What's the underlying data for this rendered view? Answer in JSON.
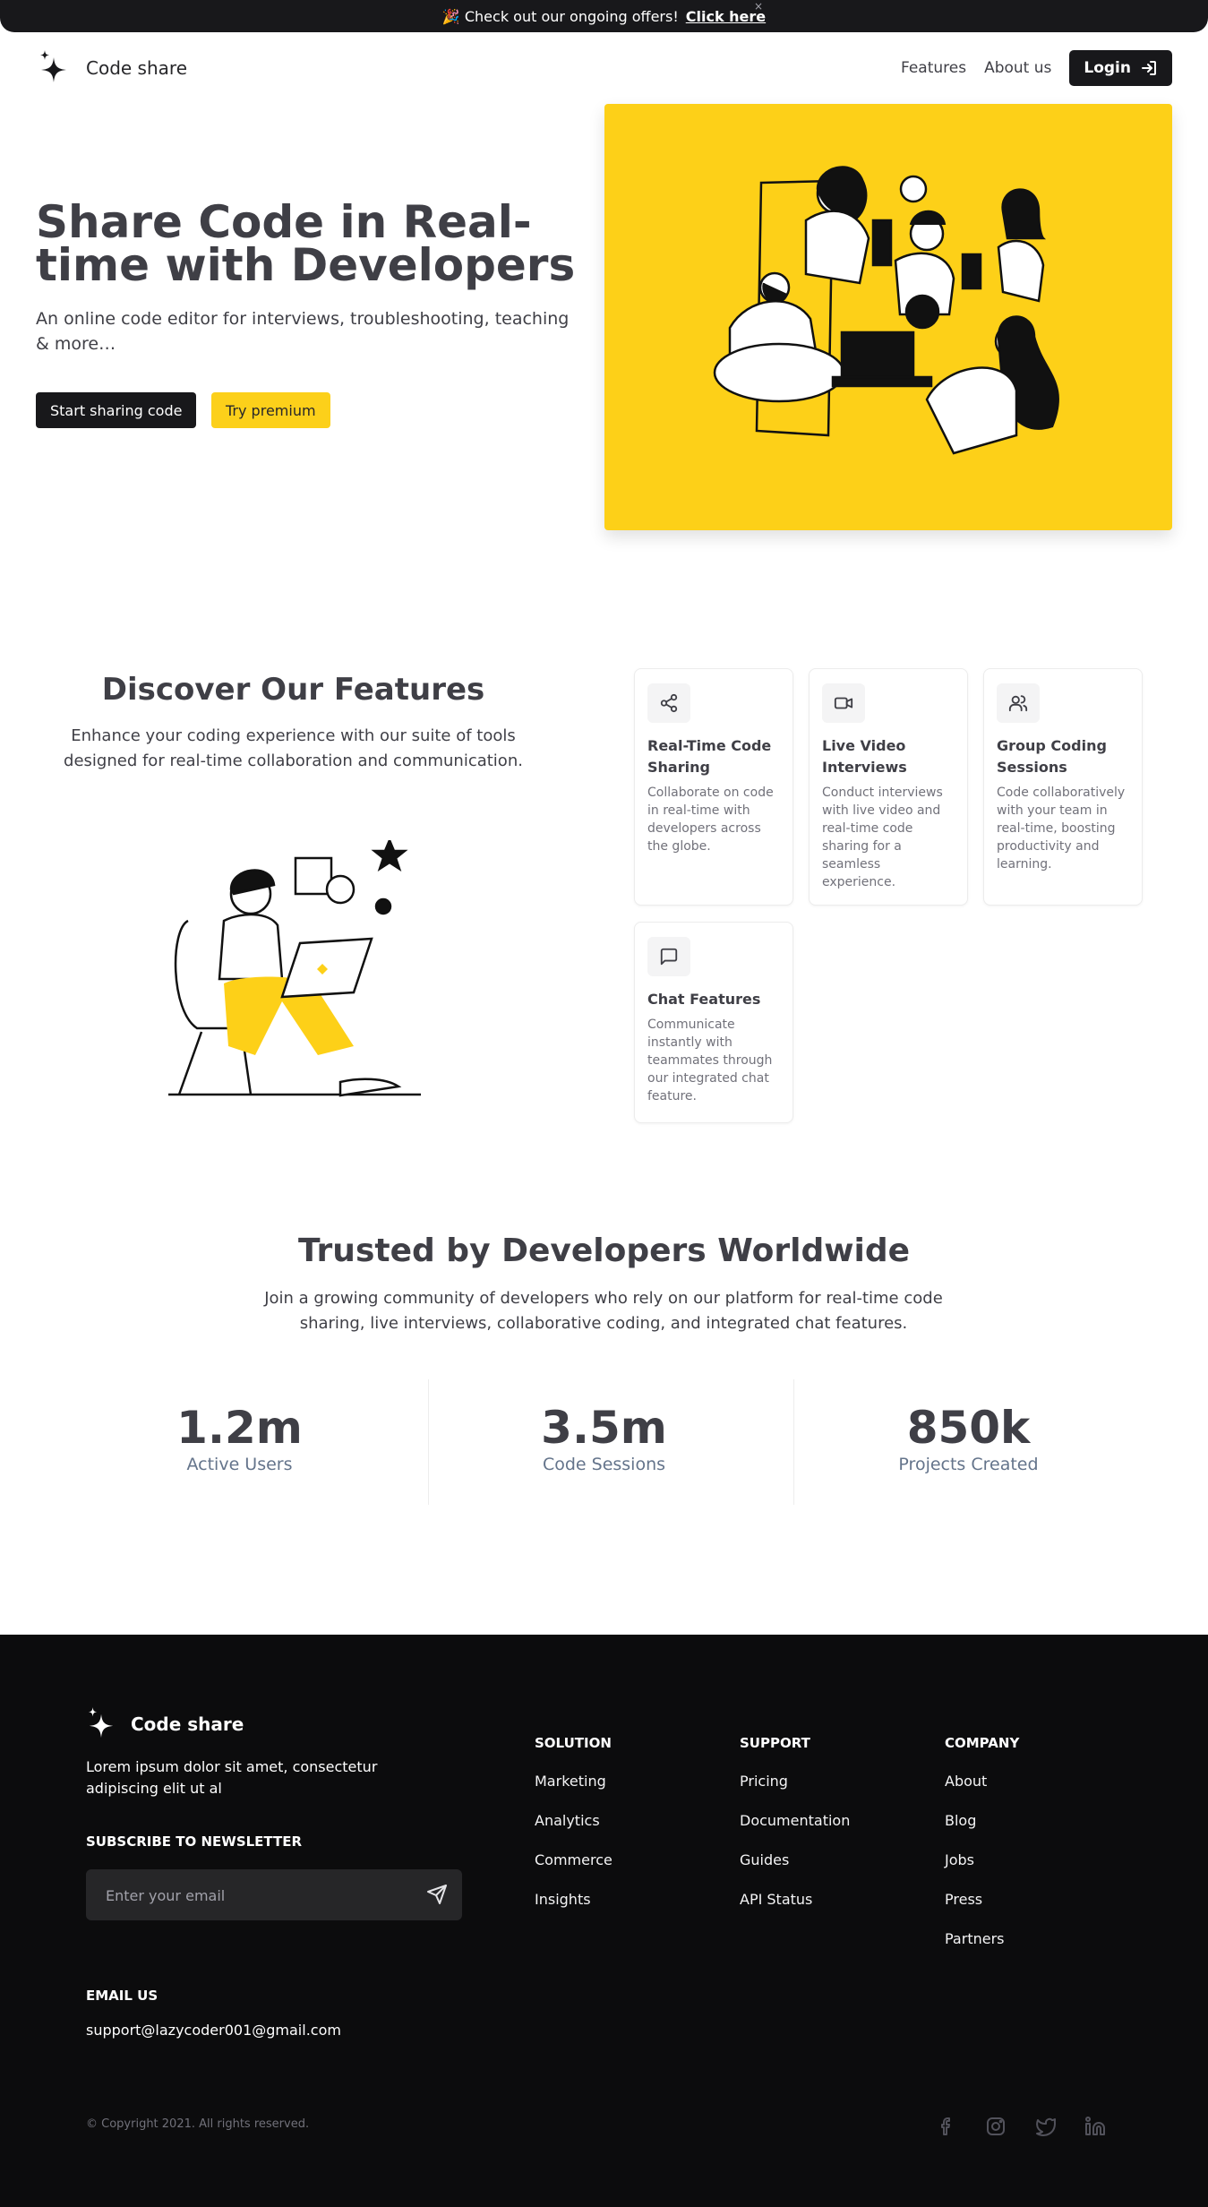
{
  "banner": {
    "message": "🎉 Check out our ongoing offers!",
    "link": "Click here",
    "close": "×"
  },
  "header": {
    "brand": "Code share",
    "nav": [
      "Features",
      "About us"
    ],
    "login": "Login"
  },
  "hero": {
    "title": "Share Code in Real-time with Developers",
    "subtitle": "An online code editor for interviews, troubleshooting, teaching & more…",
    "primary_button": "Start sharing code",
    "secondary_button": "Try premium",
    "accent_color": "#fdd018"
  },
  "features": {
    "title": "Discover Our Features",
    "subtitle": "Enhance your coding experience with our suite of tools designed for real-time collaboration and communication.",
    "cards": [
      {
        "icon": "share-icon",
        "title": "Real-Time Code Sharing",
        "desc": "Collaborate on code in real-time with developers across the globe."
      },
      {
        "icon": "video-icon",
        "title": "Live Video Interviews",
        "desc": "Conduct interviews with live video and real-time code sharing for a seamless experience."
      },
      {
        "icon": "users-icon",
        "title": "Group Coding Sessions",
        "desc": "Code collaboratively with your team in real-time, boosting productivity and learning."
      },
      {
        "icon": "chat-icon",
        "title": "Chat Features",
        "desc": "Communicate instantly with teammates through our integrated chat feature."
      }
    ]
  },
  "trusted": {
    "title": "Trusted by Developers Worldwide",
    "subtitle": "Join a growing community of developers who rely on our platform for real-time code sharing, live interviews, collaborative coding, and integrated chat features.",
    "stats": [
      {
        "value": "1.2m",
        "label": "Active Users"
      },
      {
        "value": "3.5m",
        "label": "Code Sessions"
      },
      {
        "value": "850k",
        "label": "Projects Created"
      }
    ]
  },
  "footer": {
    "brand": "Code share",
    "description": "Lorem ipsum dolor sit amet, consectetur adipiscing elit ut al",
    "newsletter_heading": "SUBSCRIBE TO NEWSLETTER",
    "newsletter_placeholder": "Enter your email",
    "email_heading": "EMAIL US",
    "email": "support@lazycoder001@gmail.com",
    "columns": [
      {
        "heading": "SOLUTION",
        "items": [
          "Marketing",
          "Analytics",
          "Commerce",
          "Insights"
        ]
      },
      {
        "heading": "SUPPORT",
        "items": [
          "Pricing",
          "Documentation",
          "Guides",
          "API Status"
        ]
      },
      {
        "heading": "COMPANY",
        "items": [
          "About",
          "Blog",
          "Jobs",
          "Press",
          "Partners"
        ]
      }
    ],
    "copyright": "© Copyright 2021. All rights reserved.",
    "social": [
      "facebook-icon",
      "instagram-icon",
      "twitter-icon",
      "linkedin-icon"
    ]
  }
}
